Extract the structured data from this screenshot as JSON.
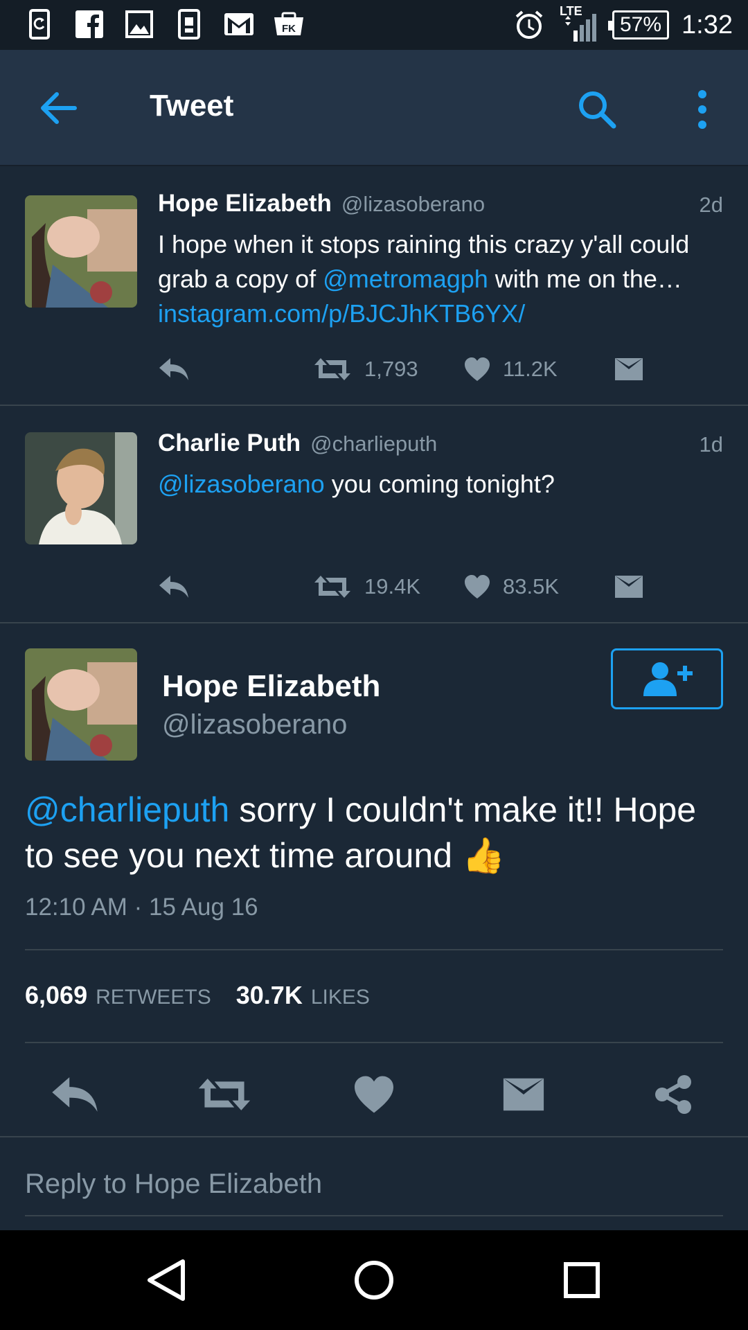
{
  "status_bar": {
    "icons": [
      "sync-app-icon",
      "facebook-icon",
      "gallery-icon",
      "phone-sim-icon",
      "gmail-icon",
      "flipkart-icon"
    ],
    "network": "LTE",
    "battery": "57%",
    "time": "1:32"
  },
  "app_bar": {
    "title": "Tweet"
  },
  "tweets": [
    {
      "name": "Hope Elizabeth",
      "handle": "@lizasoberano",
      "time": "2d",
      "text_1": "I hope when it stops raining this crazy y'all could grab a copy of ",
      "mention": "@metromagph",
      "text_2": " with me on the…",
      "link": "instagram.com/p/BJCJhKTB6YX/",
      "retweets": "1,793",
      "likes": "11.2K"
    },
    {
      "name": "Charlie Puth",
      "handle": "@charlieputh",
      "time": "1d",
      "mention": "@lizasoberano",
      "text": " you coming tonight?",
      "retweets": "19.4K",
      "likes": "83.5K"
    }
  ],
  "main_tweet": {
    "name": "Hope Elizabeth",
    "handle": "@lizasoberano",
    "mention": "@charlieputh",
    "text": " sorry I couldn't make it!! Hope to see you next time around",
    "emoji": "👍",
    "timestamp": "12:10 AM · 15 Aug 16",
    "retweet_count": "6,069",
    "retweet_label": "RETWEETS",
    "like_count": "30.7K",
    "like_label": "LIKES"
  },
  "reply": {
    "placeholder": "Reply to Hope Elizabeth"
  },
  "colors": {
    "background": "#1b2836",
    "app_bar": "#243447",
    "accent": "#1da1f2",
    "muted": "#8899a6"
  }
}
